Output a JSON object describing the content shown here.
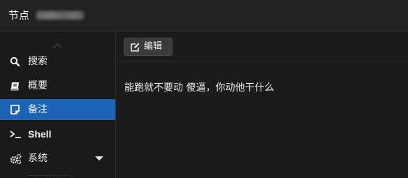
{
  "header": {
    "title": "节点",
    "node_name_obscured": true
  },
  "sidebar": {
    "items": [
      {
        "id": "search",
        "label": "搜索",
        "icon": "search-icon",
        "active": false
      },
      {
        "id": "summary",
        "label": "概要",
        "icon": "book-icon",
        "active": false
      },
      {
        "id": "notes",
        "label": "备注",
        "icon": "note-icon",
        "active": true
      },
      {
        "id": "shell",
        "label": "Shell",
        "icon": "terminal-icon",
        "active": false
      },
      {
        "id": "system",
        "label": "系统",
        "icon": "gears-icon",
        "active": false,
        "has_dropdown": true
      }
    ]
  },
  "toolbar": {
    "edit_label": "编辑",
    "edit_icon": "edit-icon"
  },
  "note": {
    "text": "能跑就不要动 傻逼，你动他干什么"
  },
  "colors": {
    "active_item": "#1d63b6",
    "background": "#1b1b1b",
    "header": "#212121",
    "button": "#3a3a3a"
  }
}
